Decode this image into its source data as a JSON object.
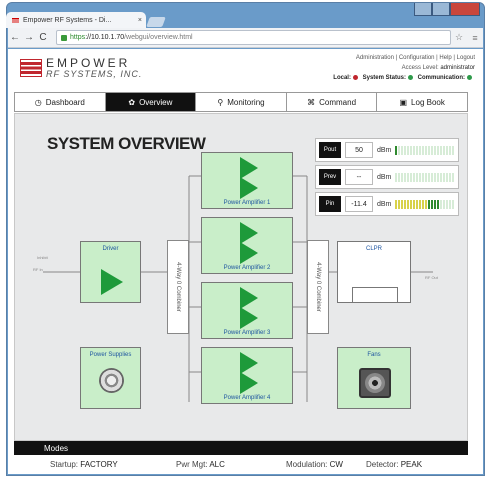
{
  "browser": {
    "tab_title": "Empower RF Systems - Di...",
    "tab_close": "×",
    "back": "←",
    "forward": "→",
    "reload": "C",
    "url_https": "https",
    "url_host": "://10.10.1.70",
    "url_path": "/webgui/overview.html",
    "star": "☆",
    "menu": "≡"
  },
  "header": {
    "logo_line1": "EMPOWER",
    "logo_line2": "RF SYSTEMS, INC.",
    "links": "Administration | Configuration | Help | Logout",
    "access_level_label": "Access Level:",
    "access_level_value": "administrator",
    "local_label": "Local:",
    "system_status_label": "System Status:",
    "communication_label": "Communication:",
    "colors": {
      "local": "#c0262e",
      "system_status": "#2e9a4a",
      "communication": "#2e9a4a"
    }
  },
  "nav": {
    "items": [
      {
        "label": "Dashboard",
        "icon": "clock-icon",
        "glyph": "◷"
      },
      {
        "label": "Overview",
        "icon": "gear-icon",
        "glyph": "✿"
      },
      {
        "label": "Monitoring",
        "icon": "search-icon",
        "glyph": "⚲"
      },
      {
        "label": "Command",
        "icon": "command-icon",
        "glyph": "⌘"
      },
      {
        "label": "Log Book",
        "icon": "book-icon",
        "glyph": "▣"
      }
    ],
    "active": "Overview"
  },
  "main": {
    "title": "SYSTEM OVERVIEW",
    "meters": [
      {
        "label": "Pout",
        "value": "50",
        "unit": "dBm",
        "level": 0.05
      },
      {
        "label": "Prev",
        "value": "--",
        "unit": "dBm",
        "level": 0
      },
      {
        "label": "Pin",
        "value": "-11.4",
        "unit": "dBm",
        "level": 0.75
      }
    ],
    "blocks": {
      "driver": "Driver",
      "pa1": "Power Amplifier 1",
      "pa2": "Power Amplifier 2",
      "pa3": "Power Amplifier 3",
      "pa4": "Power Amplifier 4",
      "divider": "4-Way 0 Combiner",
      "combiner": "4-Way 0 Combiner",
      "clpr": "CLPR",
      "power_supplies": "Power Supplies",
      "fans": "Fans",
      "inhibit": "Inhibit",
      "rf_in": "RF In",
      "rf_out": "RF Out"
    },
    "accent_green": "#c9eec9",
    "triangle_green": "#1e9a3a"
  },
  "modes": {
    "title": "Modes",
    "startup_label": "Startup:",
    "startup_value": "FACTORY",
    "pwr_label": "Pwr Mgt:",
    "pwr_value": "ALC",
    "modulation_label": "Modulation:",
    "modulation_value": "CW",
    "detector_label": "Detector:",
    "detector_value": "PEAK"
  }
}
